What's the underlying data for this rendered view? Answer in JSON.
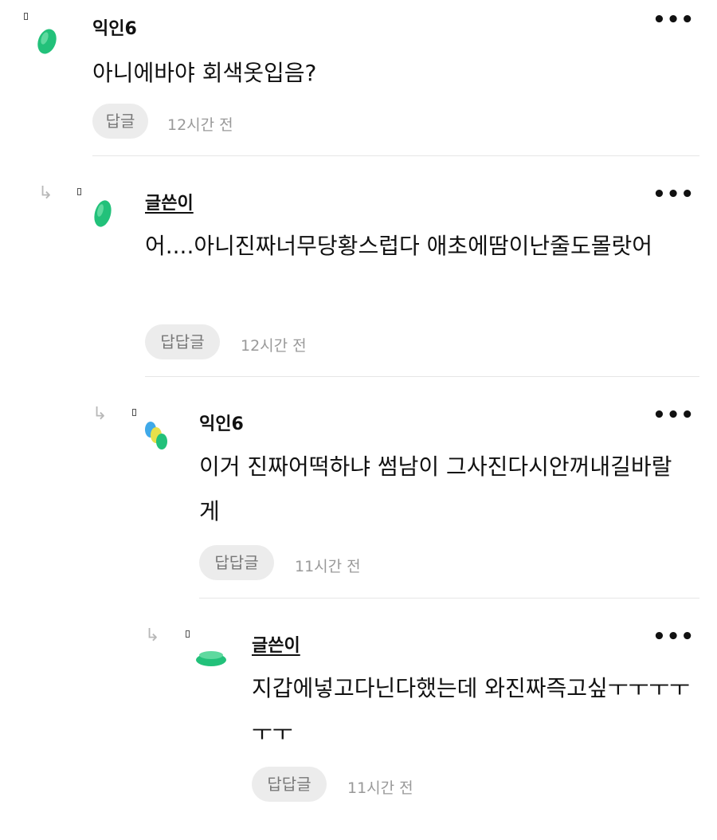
{
  "comments": [
    {
      "author": "익인6",
      "text": "아니에바야 회색옷입음?",
      "reply_label": "답글",
      "time": "12시간 전",
      "more": "•••"
    },
    {
      "author": "글쓴이",
      "text": "어....아니진짜너무당황스럽다 애초에땀이난줄도몰랏어",
      "reply_label": "답답글",
      "time": "12시간 전",
      "more": "•••",
      "reply_arrow": "↳"
    },
    {
      "author": "익인6",
      "text": "이거 진짜어떡하냐 썸남이 그사진다시안꺼내길바랄게",
      "reply_label": "답답글",
      "time": "11시간 전",
      "more": "•••",
      "reply_arrow": "↳"
    },
    {
      "author": "글쓴이",
      "text": "지갑에넣고다닌다했는데 와진짜즉고싶ㅜㅜㅜㅜㅜㅜ",
      "reply_label": "답답글",
      "time": "11시간 전",
      "more": "•••",
      "reply_arrow": "↳"
    }
  ],
  "colors": {
    "avatar_green": "#22c17a",
    "avatar_blue": "#3fa9e8",
    "avatar_yellow": "#e8e04a",
    "reply_button_bg": "#ececec",
    "divider": "#e6e6e6"
  },
  "icons": [
    "more-icon",
    "reply-arrow-icon",
    "avatar-icon"
  ]
}
